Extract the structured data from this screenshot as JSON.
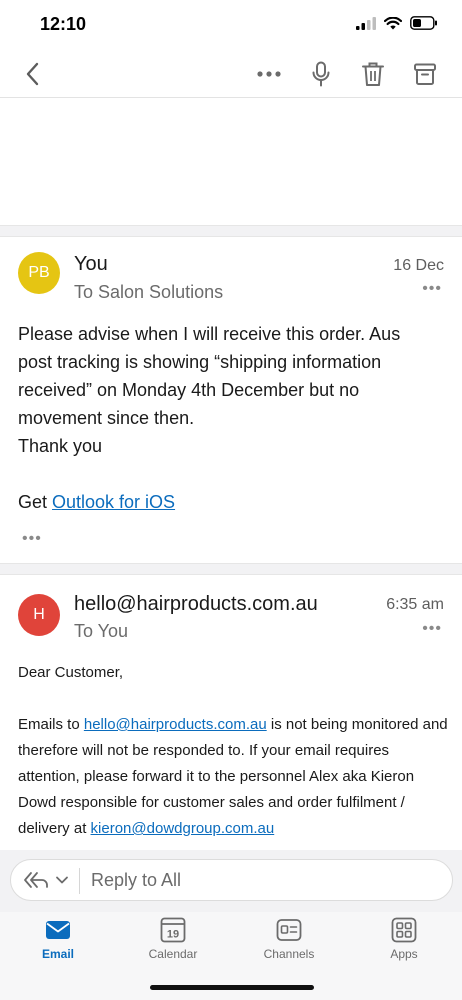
{
  "status_bar": {
    "time": "12:10"
  },
  "nav": {
    "back_icon": "chevron-left-icon",
    "actions": [
      "more-icon",
      "microphone-icon",
      "trash-icon",
      "archive-icon"
    ]
  },
  "messages": [
    {
      "avatar_initials": "PB",
      "avatar_color": "#e5c513",
      "sender": "You",
      "recipient": "To Salon Solutions",
      "date": "16 Dec",
      "more": "•••",
      "body_lines": [
        "Please advise when I will receive this order. Aus",
        "post tracking is showing “shipping information",
        "received” on Monday 4th December but no",
        "movement since then.",
        "Thank you"
      ],
      "signature_prefix": "Get ",
      "signature_link": "Outlook for iOS",
      "expand": "•••"
    },
    {
      "avatar_initials": "H",
      "avatar_color": "#e0443a",
      "sender": "hello@hairproducts.com.au",
      "recipient": "To You",
      "date": "6:35 am",
      "more": "•••",
      "greeting": "Dear Customer,",
      "body_part1": "Emails to ",
      "body_link1": "hello@hairproducts.com.au",
      "body_part2": " is not being monitored and therefore will not be responded to. If your email requires attention, please forward it to the personnel Alex aka Kieron Dowd responsible for customer sales and order fulfilment / delivery at ",
      "body_link2": "kieron@dowdgroup.com.au"
    }
  ],
  "reply": {
    "placeholder": "Reply to All"
  },
  "tabs": [
    {
      "label": "Email",
      "icon": "mail-icon",
      "active": true
    },
    {
      "label": "Calendar",
      "icon": "calendar-icon",
      "badge": "19",
      "active": false
    },
    {
      "label": "Channels",
      "icon": "channels-icon",
      "active": false
    },
    {
      "label": "Apps",
      "icon": "apps-icon",
      "active": false
    }
  ],
  "colors": {
    "accent": "#0b6cbd"
  }
}
